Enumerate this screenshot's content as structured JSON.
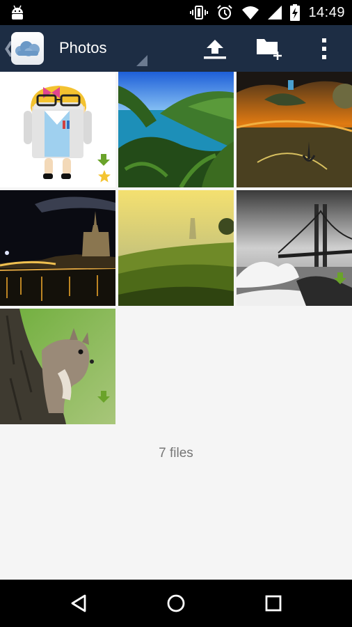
{
  "status_bar": {
    "time": "14:49",
    "icons": [
      "android-icon",
      "vibrate-icon",
      "alarm-icon",
      "wifi-icon",
      "signal-icon",
      "battery-charging-icon"
    ]
  },
  "action_bar": {
    "title": "Photos",
    "back_icon": "chevron-left-icon",
    "logo_icon": "owncloud-cloud-icon",
    "actions": [
      {
        "icon": "upload-icon"
      },
      {
        "icon": "new-folder-icon"
      },
      {
        "icon": "overflow-menu-icon"
      }
    ],
    "colors": {
      "background": "#1d2d44",
      "accent_green": "#6aa32a",
      "star": "#f4c431"
    }
  },
  "grid": {
    "items": [
      {
        "subject": "android-doctor-illustration",
        "downloaded": true,
        "favorite": true
      },
      {
        "subject": "coastal-fern-landscape",
        "downloaded": false,
        "favorite": false
      },
      {
        "subject": "surreal-sunset-water",
        "downloaded": false,
        "favorite": false
      },
      {
        "subject": "paris-night-cathedral",
        "downloaded": false,
        "favorite": false
      },
      {
        "subject": "misty-golden-meadow",
        "downloaded": false,
        "favorite": false
      },
      {
        "subject": "golden-gate-bridge-bw",
        "downloaded": true,
        "favorite": false
      },
      {
        "subject": "squirrel-on-tree",
        "downloaded": true,
        "favorite": false
      }
    ]
  },
  "footer": {
    "file_count": "7 files"
  },
  "nav_bar": {
    "buttons": [
      {
        "icon": "back-triangle-icon"
      },
      {
        "icon": "home-circle-icon"
      },
      {
        "icon": "recents-square-icon"
      }
    ]
  }
}
